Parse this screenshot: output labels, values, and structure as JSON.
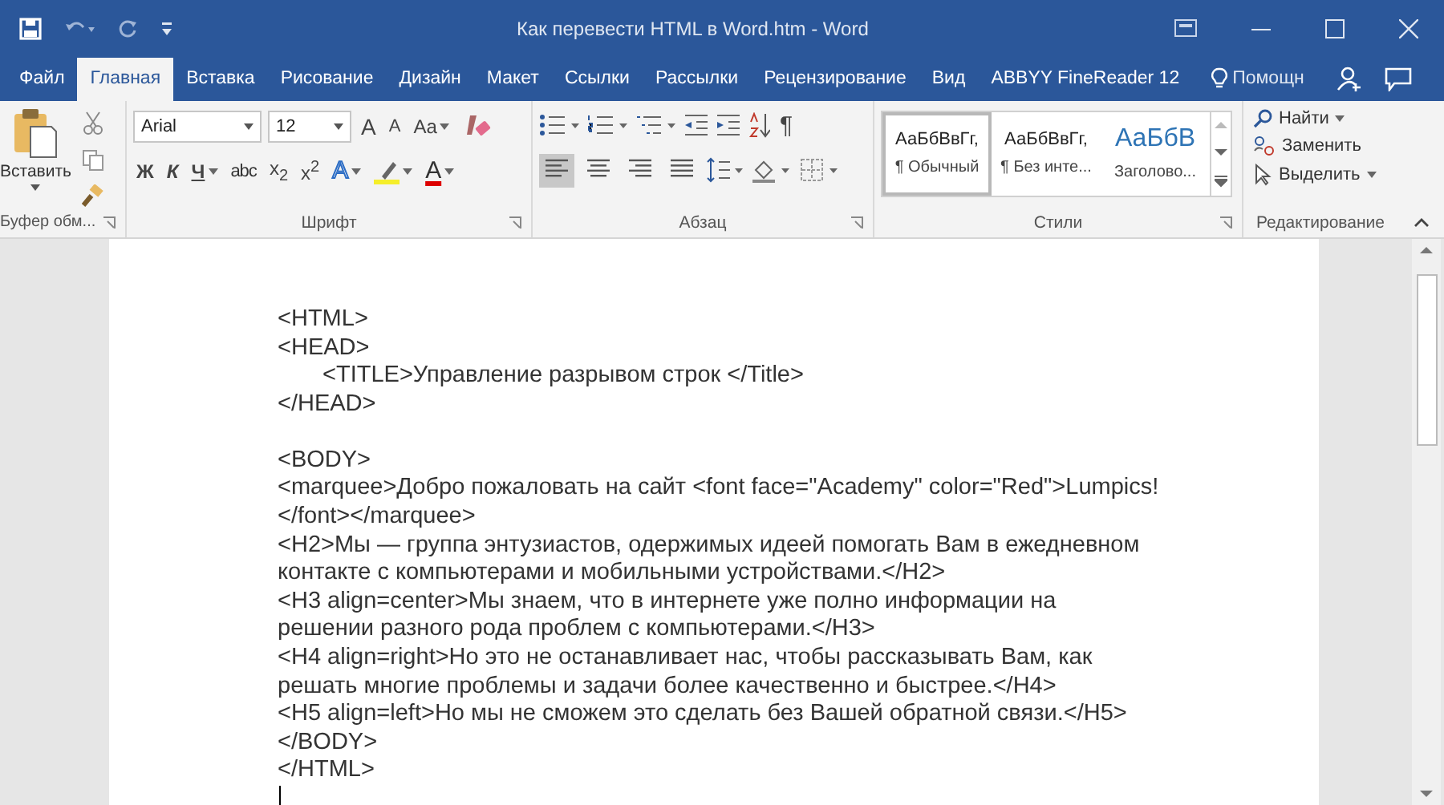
{
  "window": {
    "title": "Как перевести HTML в Word.htm - Word"
  },
  "tabs": [
    {
      "label": "Файл",
      "selected": false
    },
    {
      "label": "Главная",
      "selected": true
    },
    {
      "label": "Вставка",
      "selected": false
    },
    {
      "label": "Рисование",
      "selected": false
    },
    {
      "label": "Дизайн",
      "selected": false
    },
    {
      "label": "Макет",
      "selected": false
    },
    {
      "label": "Ссылки",
      "selected": false
    },
    {
      "label": "Рассылки",
      "selected": false
    },
    {
      "label": "Рецензирование",
      "selected": false
    },
    {
      "label": "Вид",
      "selected": false
    },
    {
      "label": "ABBYY FineReader 12",
      "selected": false
    }
  ],
  "help": {
    "label": "Помощн"
  },
  "clipboard": {
    "paste": "Вставить",
    "group": "Буфер обм..."
  },
  "font": {
    "name": "Arial",
    "size": "12",
    "group": "Шрифт",
    "row1": [
      {
        "label": "A",
        "kind": "grow",
        "dropdown": false
      },
      {
        "label": "A",
        "kind": "shrink",
        "dropdown": false
      },
      {
        "label": "Aa",
        "kind": "plain",
        "dropdown": true
      }
    ],
    "row2": [
      {
        "label": "Ж",
        "kind": "bold",
        "dropdown": false
      },
      {
        "label": "К",
        "kind": "italic",
        "dropdown": false
      },
      {
        "label": "Ч",
        "kind": "underline",
        "dropdown": true
      },
      {
        "label": "abc",
        "kind": "strike",
        "dropdown": false
      },
      {
        "label": "x$_{2}$",
        "kind": "plain",
        "dropdown": false
      },
      {
        "label": "x$^{2}$",
        "kind": "plain",
        "dropdown": false
      },
      {
        "label": "A",
        "kind": "effects",
        "dropdown": true
      },
      {
        "kind": "highlight",
        "dropdown": true
      },
      {
        "label": "A",
        "kind": "color",
        "dropdown": true
      }
    ]
  },
  "paragraph": {
    "pilcrow": "¶",
    "group": "Абзац",
    "alignment": [
      {
        "kind": "left",
        "selected": true
      },
      {
        "kind": "center",
        "selected": false
      },
      {
        "kind": "right",
        "selected": false
      },
      {
        "kind": "justify",
        "selected": false
      }
    ]
  },
  "styles": {
    "group": "Стили",
    "items": [
      {
        "sample": "АаБбВвГг,",
        "name": "¶ Обычный",
        "kind": "normal",
        "selected": true
      },
      {
        "sample": "АаБбВвГг,",
        "name": "¶ Без инте...",
        "kind": "normal",
        "selected": false
      },
      {
        "sample": "АаБбВ",
        "name": "Заголово...",
        "kind": "heading",
        "selected": false
      }
    ]
  },
  "editing": {
    "find": "Найти",
    "replace": "Заменить",
    "select": "Выделить",
    "group": "Редактирование"
  },
  "document": {
    "lines": [
      {
        "text": "<HTML>",
        "indented": false,
        "gap_before": false
      },
      {
        "text": "<HEAD>",
        "indented": false,
        "gap_before": false
      },
      {
        "text": "<TITLE>Управление разрывом строк </Title>",
        "indented": true,
        "gap_before": false
      },
      {
        "text": "</HEAD>",
        "indented": false,
        "gap_before": false
      },
      {
        "text": "<BODY>",
        "indented": false,
        "gap_before": true
      },
      {
        "text": "<marquee>Добро пожаловать на сайт <font face=\"Academy\" color=\"Red\">Lumpics!",
        "indented": false,
        "gap_before": false
      },
      {
        "text": "</font></marquee>",
        "indented": false,
        "gap_before": false
      },
      {
        "text": "<H2>Мы — группа энтузиастов, одержимых идеей помогать Вам в ежедневном",
        "indented": false,
        "gap_before": false
      },
      {
        "text": "контакте с компьютерами и мобильными устройствами.</H2>",
        "indented": false,
        "gap_before": false
      },
      {
        "text": "<H3 align=center>Мы знаем, что в интернете уже полно информации на",
        "indented": false,
        "gap_before": false
      },
      {
        "text": "решении разного рода проблем с компьютерами.</H3>",
        "indented": false,
        "gap_before": false
      },
      {
        "text": "<H4 align=right>Но это не останавливает нас, чтобы рассказывать Вам, как",
        "indented": false,
        "gap_before": false
      },
      {
        "text": "решать многие проблемы и задачи более качественно и быстрее.</H4>",
        "indented": false,
        "gap_before": false
      },
      {
        "text": "<H5 align=left>Но мы не сможем это сделать без Вашей обратной связи.</H5>",
        "indented": false,
        "gap_before": false
      },
      {
        "text": "</BODY>",
        "indented": false,
        "gap_before": false
      },
      {
        "text": "</HTML>",
        "indented": false,
        "gap_before": false
      }
    ]
  }
}
